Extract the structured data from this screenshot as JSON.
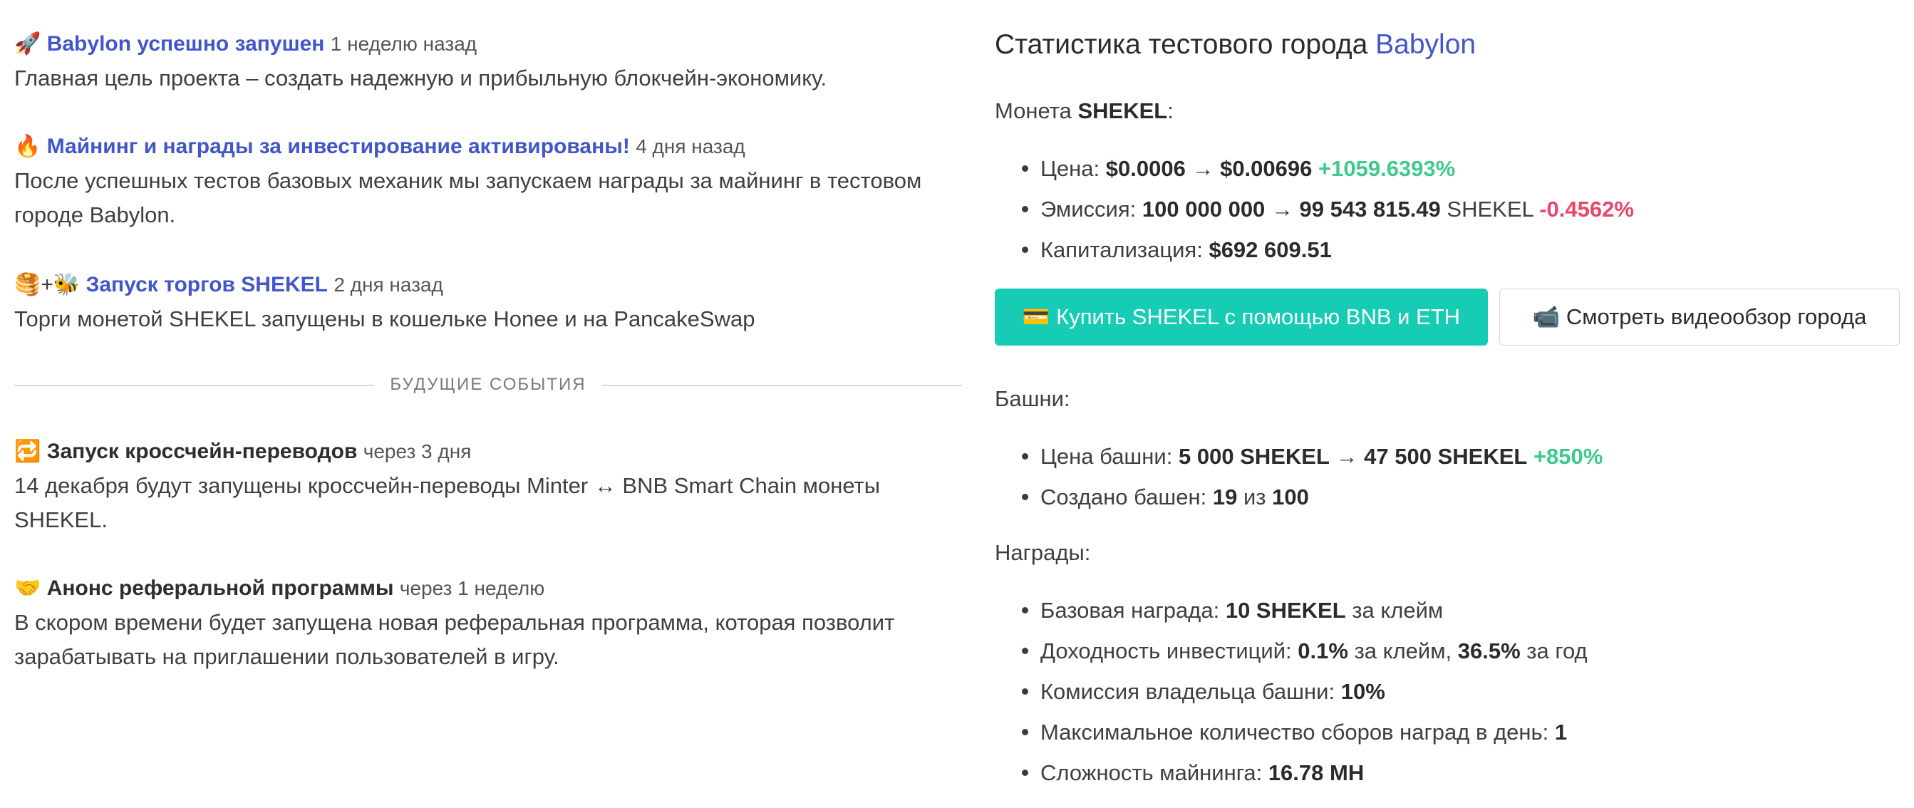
{
  "news": [
    {
      "emoji": "🚀",
      "title": "Babylon успешно запушен",
      "time": "1 неделю назад",
      "body": "Главная цель проекта – создать надежную и прибыльную блокчейн-экономику."
    },
    {
      "emoji": "🔥",
      "title": "Майнинг и награды за инвестирование активированы!",
      "time": "4 дня назад",
      "body": "После успешных тестов базовых механик мы запускаем награды за майнинг в тестовом городе Babylon."
    },
    {
      "emoji": "🥞+🐝",
      "title": "Запуск торгов SHEKEL",
      "time": "2 дня назад",
      "body": "Торги монетой SHEKEL запущены в кошельке Honee и на PancakeSwap"
    }
  ],
  "future_label": "БУДУЩИЕ СОБЫТИЯ",
  "future": [
    {
      "emoji": "🔁",
      "title": "Запуск кроссчейн-переводов",
      "time": "через 3 дня",
      "body": "14 декабря будут запущены кроссчейн-переводы Minter ↔ BNB Smart Chain монеты SHEKEL."
    },
    {
      "emoji": "🤝",
      "title": "Анонс реферальной программы",
      "time": "через 1 неделю",
      "body": "В скором времени будет запущена новая реферальная программа, которая позволит зарабатывать на приглашении пользователей в игру."
    }
  ],
  "stats": {
    "title": "Статистика тестового города",
    "city": "Babylon",
    "coin_label": "Монета",
    "coin_name": "SHEKEL",
    "price_label": "Цена:",
    "price_from": "$0.0006",
    "price_to": "$0.00696",
    "price_change": "+1059.6393%",
    "emission_label": "Эмиссия:",
    "emission_from": "100 000 000",
    "emission_to": "99 543 815.49",
    "emission_unit": "SHEKEL",
    "emission_change": "-0.4562%",
    "cap_label": "Капитализация:",
    "cap_value": "$692 609.51",
    "buy_button": "💳 Купить SHEKEL с помощью BNB и ETH",
    "video_button": "📹 Смотреть видеообзор города",
    "towers_label": "Башни:",
    "tower_price_label": "Цена башни:",
    "tower_price_from": "5 000 SHEKEL",
    "tower_price_to": "47 500 SHEKEL",
    "tower_price_change": "+850%",
    "towers_created_label": "Создано башен:",
    "towers_created": "19",
    "towers_of": "из",
    "towers_total": "100",
    "rewards_label": "Награды:",
    "base_reward_label": "Базовая награда:",
    "base_reward_value": "10 SHEKEL",
    "per_claim": "за клейм",
    "yield_label": "Доходность инвестиций:",
    "yield_claim": "0.1%",
    "yield_year": "36.5%",
    "per_year": "за год",
    "owner_fee_label": "Комиссия владельца башни:",
    "owner_fee": "10%",
    "max_claims_label": "Максимальное количество сборов наград в день:",
    "max_claims": "1",
    "difficulty_label": "Сложность майнинга:",
    "difficulty": "16.78 MH"
  }
}
